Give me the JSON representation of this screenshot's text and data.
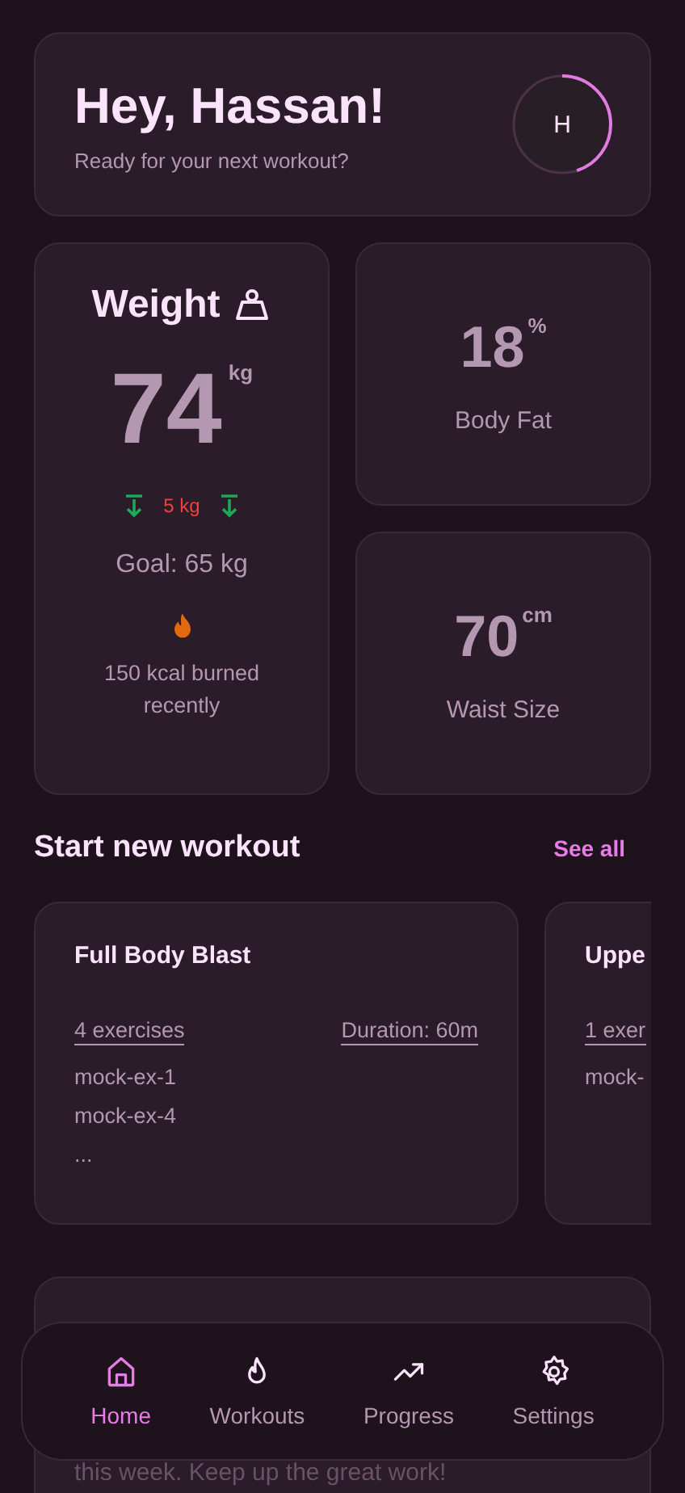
{
  "header": {
    "title": "Hey, Hassan!",
    "subtitle": "Ready for your next workout?",
    "avatar": {
      "initial": "H",
      "level": 0.45
    }
  },
  "weight": {
    "title": "Weight",
    "value": "74",
    "unit": "kg",
    "change": "5 kg",
    "goal": "Goal: 65 kg",
    "burned": "150 kcal burned recently"
  },
  "stats": [
    {
      "value": "18",
      "unit": "%",
      "label": "Body Fat"
    },
    {
      "value": "70",
      "unit": "cm",
      "label": "Waist Size"
    }
  ],
  "workouts_section": {
    "title": "Start new workout",
    "link": "See all"
  },
  "workouts": [
    {
      "name": "Full Body Blast",
      "count": "4 exercises",
      "duration": "Duration: 60m",
      "exercises": [
        "mock-ex-1",
        "mock-ex-4",
        "..."
      ]
    },
    {
      "name": "Uppe",
      "count": "1 exer",
      "exercises": [
        "mock-"
      ]
    }
  ],
  "summary_card": {
    "text": "this week. Keep up the great work!"
  },
  "nav": [
    {
      "label": "Home",
      "kind": "home",
      "selected": true
    },
    {
      "label": "Workouts",
      "kind": "flame",
      "selected": false
    },
    {
      "label": "Progress",
      "kind": "trend",
      "selected": false
    },
    {
      "label": "Settings",
      "kind": "gear",
      "selected": false
    }
  ]
}
